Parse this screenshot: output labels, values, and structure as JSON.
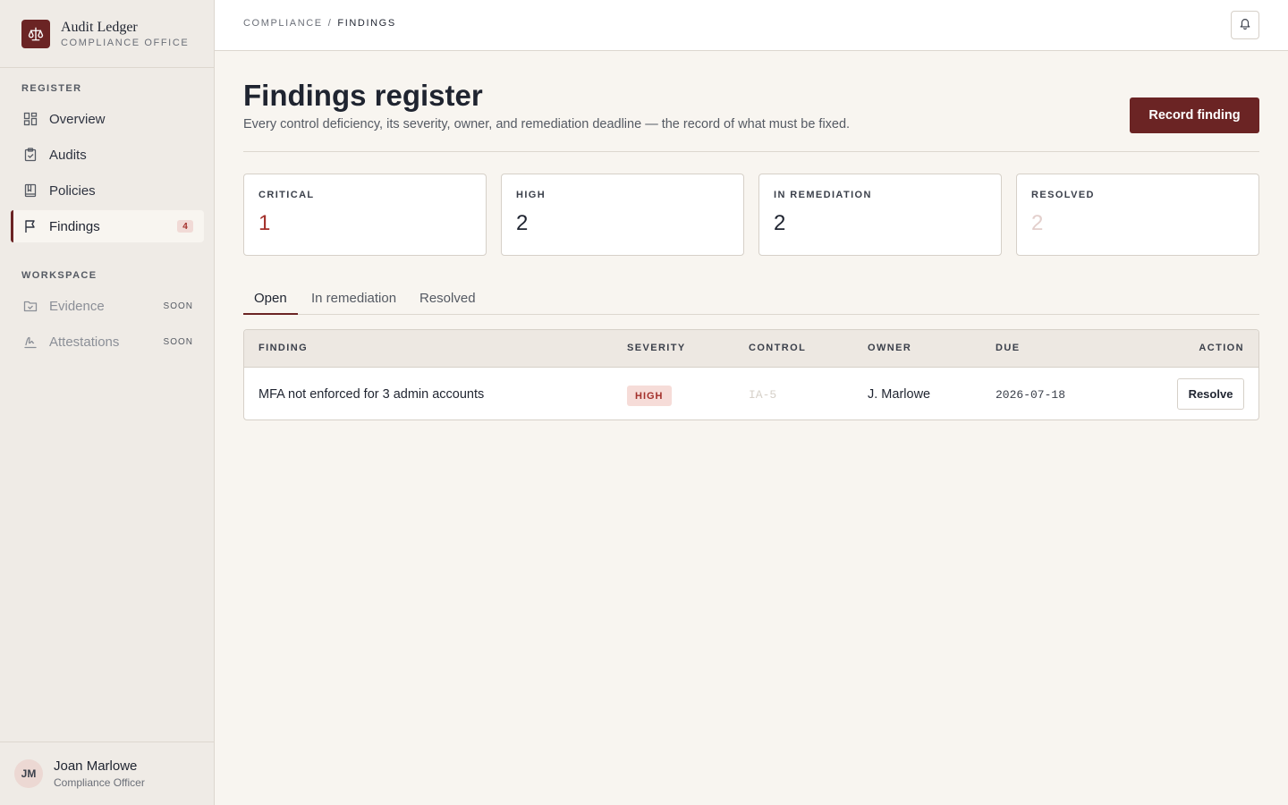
{
  "brand": {
    "title": "Audit Ledger",
    "subtitle": "COMPLIANCE OFFICE",
    "logo_icon": "scales-icon"
  },
  "sidebar": {
    "sections": [
      {
        "label": "REGISTER",
        "items": [
          {
            "label": "Overview",
            "icon": "dashboard-grid-icon"
          },
          {
            "label": "Audits",
            "icon": "clipboard-check-icon"
          },
          {
            "label": "Policies",
            "icon": "book-icon"
          },
          {
            "label": "Findings",
            "icon": "flag-icon",
            "badge": "4",
            "active": true
          }
        ]
      },
      {
        "label": "WORKSPACE",
        "items": [
          {
            "label": "Evidence",
            "icon": "folder-check-icon",
            "tag": "SOON"
          },
          {
            "label": "Attestations",
            "icon": "signature-icon",
            "tag": "SOON"
          }
        ]
      }
    ]
  },
  "user": {
    "initials": "JM",
    "name": "Joan Marlowe",
    "role": "Compliance Officer"
  },
  "breadcrumb": {
    "parent": "COMPLIANCE",
    "separator": "/",
    "current": "FINDINGS"
  },
  "page": {
    "title": "Findings register",
    "subtitle": "Every control deficiency, its severity, owner, and remediation deadline — the record of what must be fixed.",
    "primary_action": "Record finding"
  },
  "stats": [
    {
      "label": "CRITICAL",
      "value": "1",
      "color": "#a3302b"
    },
    {
      "label": "HIGH",
      "value": "2",
      "color": "#1f2430"
    },
    {
      "label": "IN REMEDIATION",
      "value": "2",
      "color": "#1f2430"
    },
    {
      "label": "RESOLVED",
      "value": "2",
      "color": "#e3cfcc"
    }
  ],
  "tabs": [
    {
      "label": "Open",
      "active": true
    },
    {
      "label": "In remediation"
    },
    {
      "label": "Resolved"
    }
  ],
  "table": {
    "columns": [
      "FINDING",
      "SEVERITY",
      "CONTROL",
      "OWNER",
      "DUE",
      "ACTION"
    ],
    "rows": [
      {
        "finding": "MFA not enforced for 3 admin accounts",
        "severity": "HIGH",
        "control": "IA-5",
        "owner": "J. Marlowe",
        "due": "2026-07-18",
        "action": "Resolve"
      }
    ]
  },
  "colors": {
    "accent": "#6b2424",
    "background": "#f8f5f0",
    "sidebar": "#efebe6"
  }
}
